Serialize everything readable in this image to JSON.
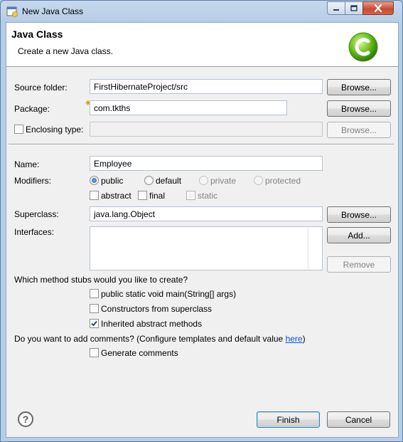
{
  "window": {
    "title": "New Java Class",
    "controls": {
      "minimize": "minimize",
      "maximize": "maximize",
      "close": "close"
    }
  },
  "banner": {
    "title": "Java Class",
    "description": "Create a new Java class.",
    "icon": "java-class-icon"
  },
  "form": {
    "source_folder": {
      "label": "Source folder:",
      "value": "FirstHibernateProject/src",
      "browse": "Browse..."
    },
    "package": {
      "label": "Package:",
      "value": "com.tkths",
      "browse": "Browse..."
    },
    "enclosing_type": {
      "label": "Enclosing type:",
      "value": "",
      "browse": "Browse...",
      "checked": false
    },
    "name": {
      "label": "Name:",
      "value": "Employee"
    },
    "modifiers": {
      "label": "Modifiers:",
      "access": [
        "public",
        "default",
        "private",
        "protected"
      ],
      "selected": "public",
      "abstract": "abstract",
      "final": "final",
      "static": "static"
    },
    "superclass": {
      "label": "Superclass:",
      "value": "java.lang.Object",
      "browse": "Browse..."
    },
    "interfaces": {
      "label": "Interfaces:",
      "add": "Add...",
      "remove": "Remove"
    }
  },
  "stubs": {
    "question": "Which method stubs would you like to create?",
    "options": [
      {
        "label": "public static void main(String[] args)",
        "checked": false
      },
      {
        "label": "Constructors from superclass",
        "checked": false
      },
      {
        "label": "Inherited abstract methods",
        "checked": true
      }
    ]
  },
  "comments": {
    "question_prefix": "Do you want to add comments? (Configure templates and default value ",
    "link": "here",
    "question_suffix": ")",
    "option": {
      "label": "Generate comments",
      "checked": false
    }
  },
  "footer": {
    "help_icon": "help-icon",
    "help_glyph": "?",
    "finish": "Finish",
    "cancel": "Cancel"
  },
  "colors": {
    "link": "#0b58c5",
    "checkmark": "#1d3c6e",
    "titlebar": "#c6d9ee",
    "close_button": "#c84b33"
  }
}
